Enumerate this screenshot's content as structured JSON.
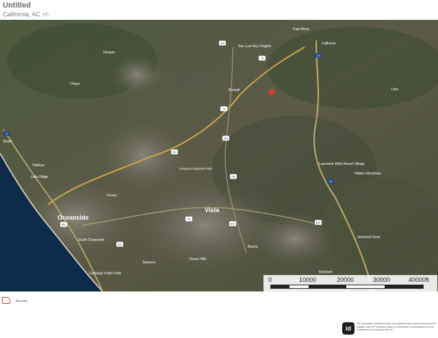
{
  "header": {
    "title": "Untitled",
    "subtitle": "California, AC +/-"
  },
  "map": {
    "places": [
      {
        "name": "Oceanside",
        "size": "large"
      },
      {
        "name": "Vista",
        "size": "large"
      },
      {
        "name": "Fallbrook",
        "size": "small"
      },
      {
        "name": "Bonsall",
        "size": "small"
      },
      {
        "name": "San Luis Rey Heights",
        "size": "small"
      },
      {
        "name": "Pala Mesa",
        "size": "small"
      },
      {
        "name": "Jofegan",
        "size": "small"
      },
      {
        "name": "Chapo",
        "size": "small"
      },
      {
        "name": "Stuart",
        "size": "small"
      },
      {
        "name": "Yaldoya",
        "size": "small"
      },
      {
        "name": "Lake Ridge",
        "size": "small"
      },
      {
        "name": "Guajome Regional Park",
        "size": "small"
      },
      {
        "name": "Ocean",
        "size": "small"
      },
      {
        "name": "South Oceanside",
        "size": "small"
      },
      {
        "name": "Carlsbad Trailer Park",
        "size": "small"
      },
      {
        "name": "Talavera",
        "size": "small"
      },
      {
        "name": "Lawrence Welk Resort Village",
        "size": "small"
      },
      {
        "name": "Hidden Meadows",
        "size": "small"
      },
      {
        "name": "Jesmond Dene",
        "size": "small"
      },
      {
        "name": "Richland",
        "size": "small"
      },
      {
        "name": "Buena",
        "size": "small"
      },
      {
        "name": "Ocean Hills",
        "size": "small"
      },
      {
        "name": "Lilac",
        "size": "small"
      }
    ],
    "route_shields": [
      "S13",
      "76",
      "15",
      "76",
      "S13",
      "S14",
      "S13",
      "5",
      "S21",
      "S14",
      "S12",
      "15",
      "S11",
      "78"
    ]
  },
  "scale": {
    "ticks": [
      "0",
      "10000",
      "20000",
      "30000",
      "40000ft"
    ]
  },
  "legend": {
    "label": "Boundary",
    "color": "#c0392b"
  },
  "footer": {
    "logo_text": "id",
    "disclaimer": "The information contained herein was obtained from sources deemed to be reliable. Land id™ Services makes no warranties or guarantees as to the completeness or accuracy thereof."
  }
}
